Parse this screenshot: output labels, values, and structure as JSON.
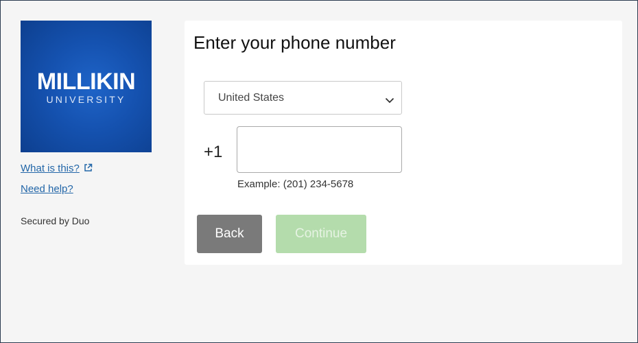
{
  "brand": {
    "name": "MILLIKIN",
    "subtitle": "UNIVERSITY"
  },
  "sidebar": {
    "what_is_this": "What is this?",
    "need_help": "Need help?",
    "secured_by": "Secured by Duo"
  },
  "form": {
    "title": "Enter your phone number",
    "country_selected": "United States",
    "country_code": "+1",
    "phone_value": "",
    "phone_placeholder": "",
    "example": "Example: (201) 234-5678",
    "back_label": "Back",
    "continue_label": "Continue"
  },
  "colors": {
    "logo_bg": "#1552b0",
    "link": "#2266a8",
    "back_button": "#7a7a7a",
    "continue_button_disabled": "#b4dcac"
  },
  "icons": {
    "external_link": "external-link-icon",
    "dropdown": "chevron-down-icon"
  }
}
